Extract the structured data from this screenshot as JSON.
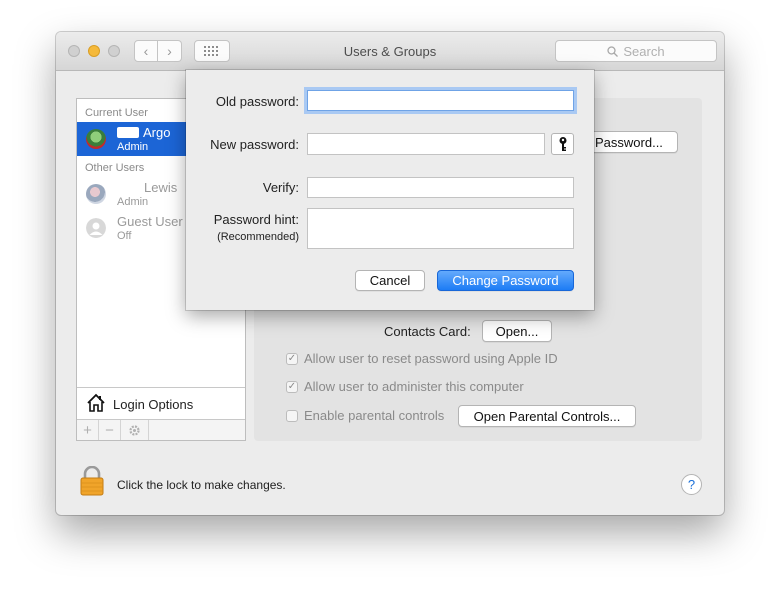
{
  "window": {
    "title": "Users & Groups"
  },
  "search": {
    "placeholder": "Search"
  },
  "sidebar": {
    "current_user_heading": "Current User",
    "current_user": {
      "name": "Argo",
      "role": "Admin"
    },
    "other_users_heading": "Other Users",
    "other_users": [
      {
        "name": "Lewis",
        "role": "Admin"
      },
      {
        "name": "Guest User",
        "role": "Off"
      }
    ],
    "login_options_label": "Login Options",
    "add_symbol": "+",
    "remove_symbol": "−"
  },
  "main": {
    "change_password_button": "Password...",
    "contacts_card_label": "Contacts Card:",
    "open_button": "Open...",
    "checkboxes": [
      {
        "label": "Allow user to reset password using Apple ID",
        "checked": true
      },
      {
        "label": "Allow user to administer this computer",
        "checked": true
      },
      {
        "label": "Enable parental controls",
        "checked": false
      }
    ],
    "open_parental_button": "Open Parental Controls..."
  },
  "footer": {
    "lock_text": "Click the lock to make changes.",
    "help_symbol": "?"
  },
  "dialog": {
    "old_password_label": "Old password:",
    "old_password_value": "",
    "new_password_label": "New password:",
    "new_password_value": "",
    "verify_label": "Verify:",
    "verify_value": "",
    "hint_label": "Password hint:",
    "hint_sublabel": "(Recommended)",
    "hint_value": "",
    "cancel_label": "Cancel",
    "change_label": "Change Password"
  },
  "colors": {
    "selection": "#1c65d6",
    "primary_button": "#1d7cf5",
    "focus_ring": "#a9c9f3",
    "lock": "#f0a42a"
  }
}
